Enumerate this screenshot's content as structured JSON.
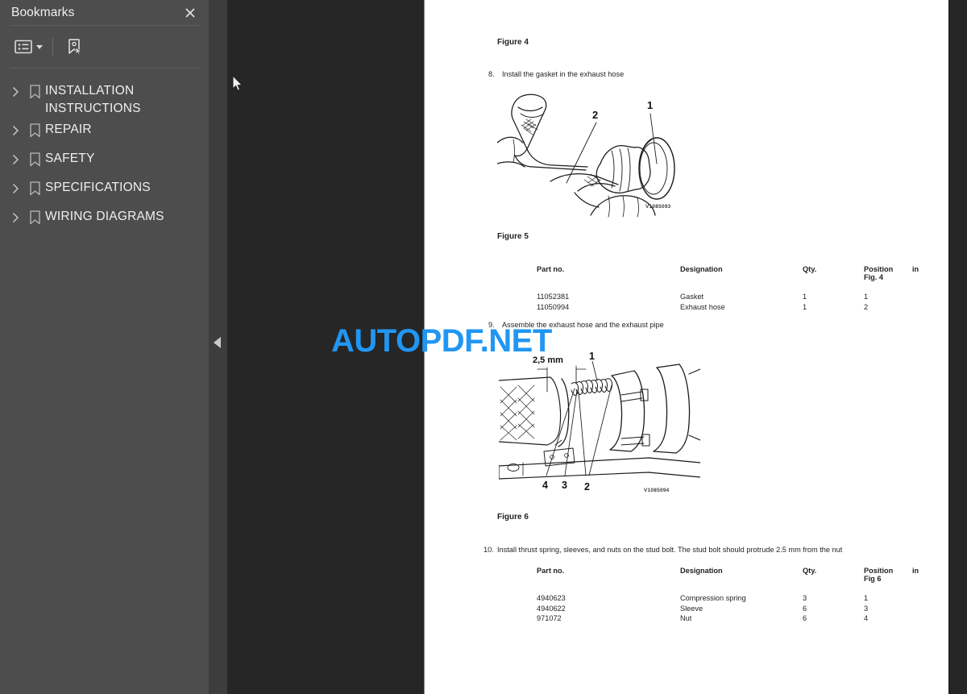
{
  "sidebar": {
    "title": "Bookmarks",
    "close_label": "×",
    "toolbar": [
      {
        "name": "bookmark-options-icon",
        "label": "Bookmark options"
      },
      {
        "name": "new-bookmark-icon",
        "label": "New bookmark"
      }
    ],
    "items": [
      {
        "label": "INSTALLATION INSTRUCTIONS"
      },
      {
        "label": "REPAIR"
      },
      {
        "label": "SAFETY"
      },
      {
        "label": "SPECIFICATIONS"
      },
      {
        "label": "WIRING DIAGRAMS"
      }
    ]
  },
  "watermark": {
    "text": "AUTOPDF.NET",
    "color": "#2196f3"
  },
  "document": {
    "figure4_label": "Figure 4",
    "figure5_label": "Figure 5",
    "figure6_label": "Figure 6",
    "step8": {
      "number": "8.",
      "text": "Install the gasket in the exhaust hose"
    },
    "step9": {
      "number": "9.",
      "text": "Assemble the exhaust hose and the exhaust pipe"
    },
    "step10": {
      "number": "10.",
      "text": "Install thrust spring, sleeves, and nuts on the stud bolt. The stud bolt should protrude 2.5 mm from the nut"
    },
    "figure1": {
      "image_id": "V1085093",
      "callouts": [
        "1",
        "2"
      ]
    },
    "figure2": {
      "image_id": "V1085094",
      "dimension": "2,5 mm",
      "callouts": [
        "1",
        "2",
        "3",
        "4"
      ]
    },
    "table1": {
      "headers": [
        "Part no.",
        "Designation",
        "Qty.",
        "Position",
        "in"
      ],
      "subheader": "Fig. 4",
      "rows": [
        {
          "part": "11052381",
          "designation": "Gasket",
          "qty": "1",
          "position": "1"
        },
        {
          "part": "11050994",
          "designation": "Exhaust hose",
          "qty": "1",
          "position": "2"
        }
      ]
    },
    "table2": {
      "headers": [
        "Part no.",
        "Designation",
        "Qty.",
        "Position",
        "in"
      ],
      "subheader": "Fig 6",
      "rows": [
        {
          "part": "4940623",
          "designation": "Compression spring",
          "qty": "3",
          "position": "1"
        },
        {
          "part": "4940622",
          "designation": "Sleeve",
          "qty": "6",
          "position": "3"
        },
        {
          "part": "971072",
          "designation": "Nut",
          "qty": "6",
          "position": "4"
        }
      ]
    }
  }
}
